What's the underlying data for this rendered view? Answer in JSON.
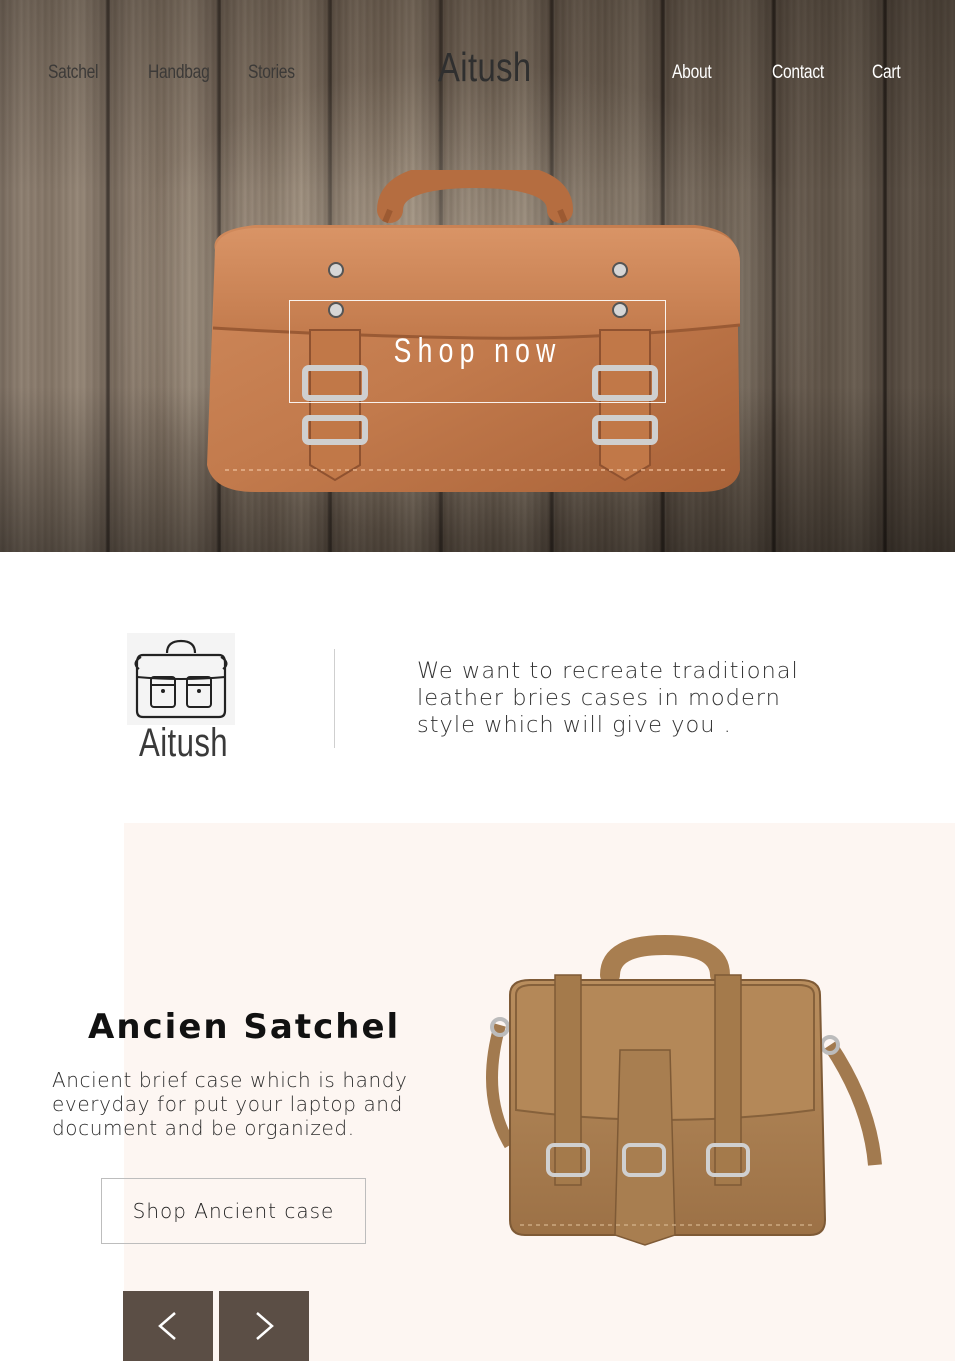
{
  "nav": {
    "left": [
      "Satchel",
      "Handbag",
      "Stories"
    ],
    "brand": "Aitush",
    "right": [
      "About",
      "Contact",
      "Cart"
    ]
  },
  "hero": {
    "cta": "Shop now"
  },
  "intro": {
    "logo_text": "Aitush",
    "mission": "We want to recreate traditional leather bries cases in modern style which will give you ."
  },
  "product": {
    "title": "Ancien Satchel",
    "description": "Ancient brief case which is handy everyday for put your laptop and document and be organized.",
    "cta": "Shop Ancient case"
  },
  "icons": {
    "prev": "chevron-left-icon",
    "next": "chevron-right-icon"
  },
  "colors": {
    "product_bg": "#fdf6f2",
    "slider_button": "#5b4e45",
    "leather": "#c47a4e"
  }
}
